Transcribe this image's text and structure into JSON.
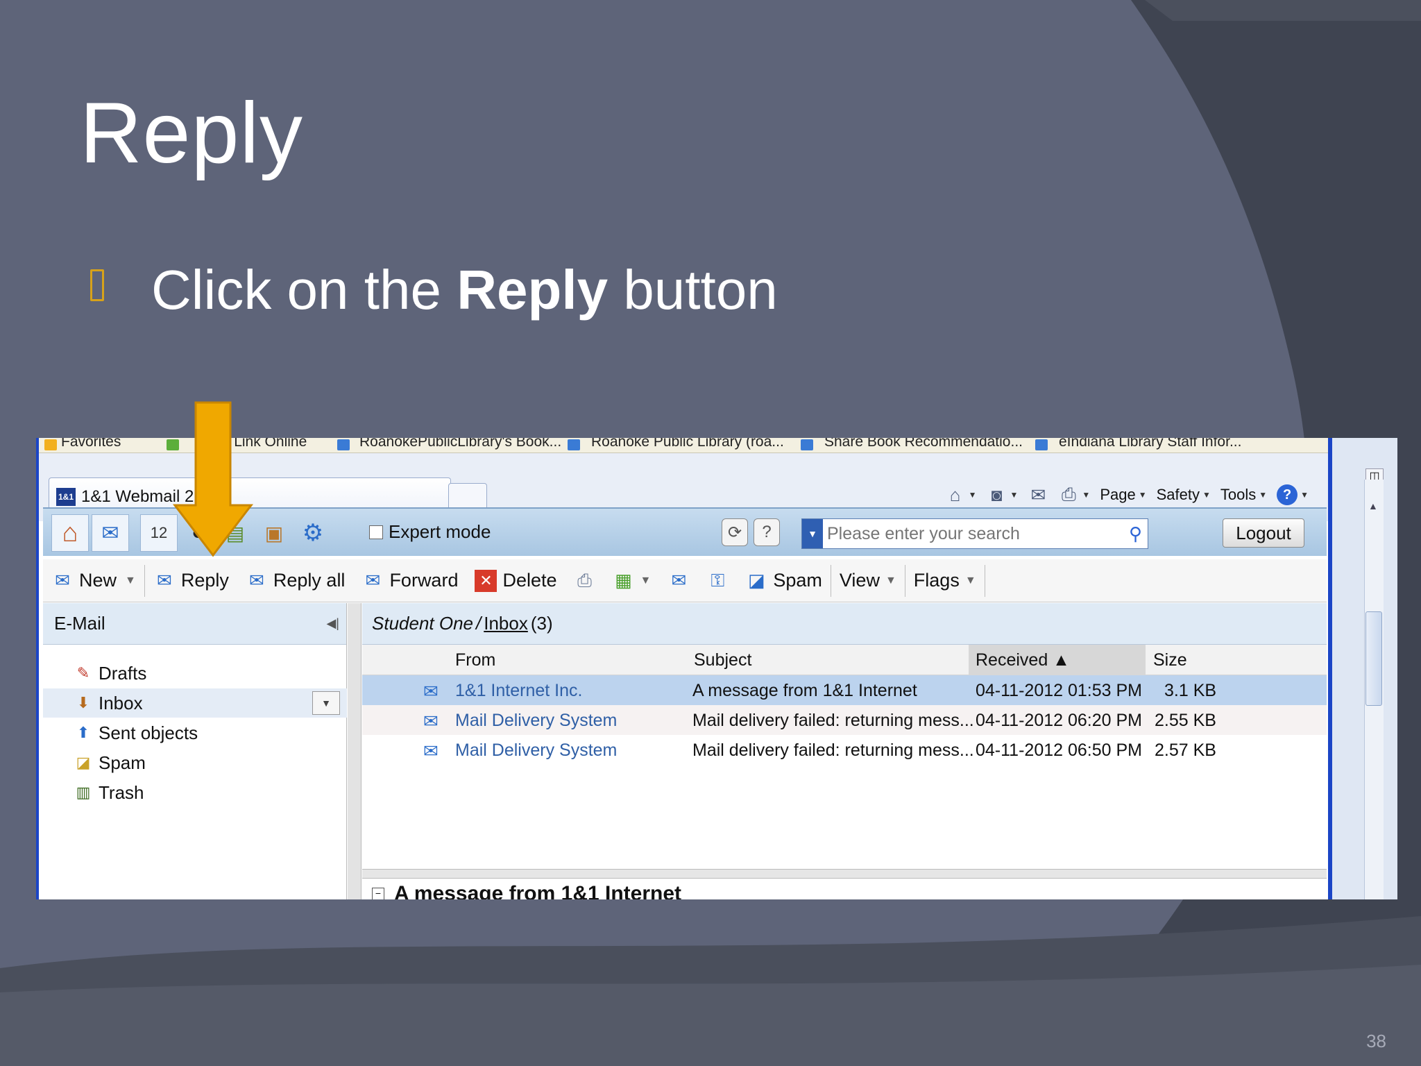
{
  "slide": {
    "title": "Reply",
    "bullet_prefix": "Click on the ",
    "bullet_bold": "Reply",
    "bullet_suffix": " button",
    "page_number": "38"
  },
  "browser": {
    "favorites": [
      "Favorites",
      "1&1 Link Online",
      "RoanokePublicLibrary's Book...",
      "Roanoke Public Library (roa...",
      "Share Book Recommendatio...",
      "eIndiana Library Staff Infor..."
    ],
    "tab_logo": "1&1",
    "tab_title": "1&1 Webmail 2.0",
    "commands": {
      "page": "Page",
      "safety": "Safety",
      "tools": "Tools",
      "help": "?"
    }
  },
  "app_toolbar": {
    "calendar_day": "12",
    "expert_mode_label": "Expert mode",
    "refresh_symbol": "⟳",
    "help_symbol": "?",
    "search_placeholder": "Please enter your search",
    "logout_label": "Logout"
  },
  "actions": {
    "new": "New",
    "reply": "Reply",
    "reply_all": "Reply all",
    "forward": "Forward",
    "delete": "Delete",
    "spam": "Spam",
    "view": "View",
    "flags": "Flags"
  },
  "sidebar": {
    "header": "E-Mail",
    "folders": [
      {
        "label": "Drafts",
        "icon": "drafts-icon"
      },
      {
        "label": "Inbox",
        "icon": "inbox-icon",
        "selected": true
      },
      {
        "label": "Sent objects",
        "icon": "sent-icon"
      },
      {
        "label": "Spam",
        "icon": "spam-folder-icon"
      },
      {
        "label": "Trash",
        "icon": "trash-icon"
      }
    ]
  },
  "mailbox": {
    "user": "Student One",
    "separator": " / ",
    "folder": "Inbox",
    "count": "(3)",
    "columns": {
      "from": "From",
      "subject": "Subject",
      "received": "Received ▲",
      "size": "Size"
    },
    "messages": [
      {
        "from": "1&1 Internet Inc.",
        "subject": "A message from 1&1 Internet",
        "received": "04-11-2012 01:53 PM",
        "size": "3.1 KB"
      },
      {
        "from": "Mail Delivery System",
        "subject": "Mail delivery failed: returning mess...",
        "received": "04-11-2012 06:20 PM",
        "size": "2.55 KB"
      },
      {
        "from": "Mail Delivery System",
        "subject": "Mail delivery failed: returning mess...",
        "received": "04-11-2012 06:50 PM",
        "size": "2.57 KB"
      }
    ],
    "preview_title": "A message from 1&1 Internet"
  },
  "colors": {
    "slide_bg": "#5e6479",
    "arrow": "#f0a800",
    "selection": "#bcd3ee",
    "link_blue": "#2f5fa6"
  }
}
